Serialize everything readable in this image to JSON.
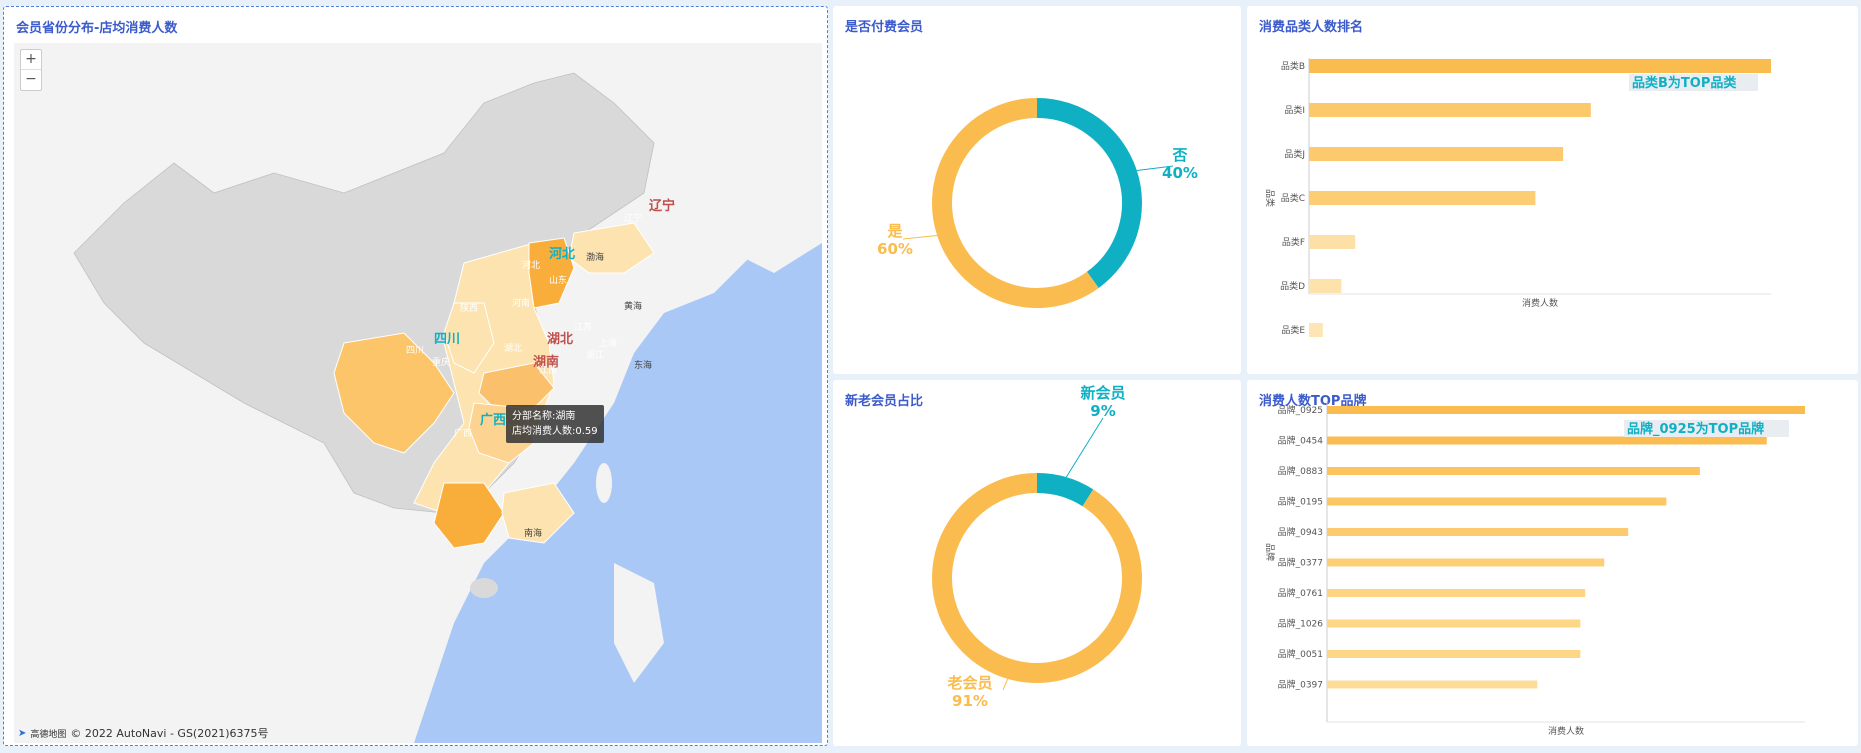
{
  "map_panel": {
    "title": "会员省份分布-店均消费人数",
    "zoom_in": "+",
    "zoom_out": "−",
    "credit": "高德地图",
    "copyright": "© 2022 AutoNavi - GS(2021)6375号",
    "tooltip_line1": "分部名称:湖南",
    "tooltip_line2": "店均消费人数:0.59",
    "sea_labels": [
      "渤海",
      "黄海",
      "东海",
      "南海"
    ],
    "region_labels": [
      "辽宁",
      "河北",
      "四川",
      "湖北",
      "湖南",
      "广西"
    ],
    "province_labels": [
      "辽宁",
      "河北",
      "山东",
      "陕西",
      "河南",
      "江苏",
      "四川",
      "重庆",
      "湖北",
      "上海",
      "浙江",
      "江西",
      "广西",
      "广东"
    ]
  },
  "pay_panel": {
    "title": "是否付费会员",
    "chart_data": {
      "type": "pie",
      "labels": [
        "否",
        "是"
      ],
      "values": [
        40,
        60
      ],
      "value_labels": [
        "40%",
        "60%"
      ],
      "colors": [
        "#0fb0c4",
        "#fbbc4f"
      ]
    }
  },
  "category_panel": {
    "title": "消费品类人数排名",
    "annotation": "品类B为TOP品类",
    "chart_data": {
      "type": "bar",
      "orientation": "horizontal",
      "categories": [
        "品类B",
        "品类I",
        "品类J",
        "品类C",
        "品类F",
        "品类D",
        "品类E"
      ],
      "values": [
        100,
        61,
        55,
        49,
        10,
        7,
        3
      ],
      "ylabel": "品类",
      "xlabel": "消费人数",
      "colors": [
        "#fbbc4f",
        "#fcc96a",
        "#fcca6c",
        "#fccd72",
        "#fde0a5",
        "#fde3ab",
        "#fde6b3"
      ]
    }
  },
  "new_panel": {
    "title": "新老会员占比",
    "chart_data": {
      "type": "pie",
      "labels": [
        "新会员",
        "老会员"
      ],
      "values": [
        9,
        91
      ],
      "value_labels": [
        "9%",
        "91%"
      ],
      "colors": [
        "#0fb0c4",
        "#fbbc4f"
      ]
    }
  },
  "brand_panel": {
    "title": "消费人数TOP品牌",
    "annotation": "品牌_0925为TOP品牌",
    "chart_data": {
      "type": "bar",
      "orientation": "horizontal",
      "categories": [
        "品牌_0925",
        "品牌_0454",
        "品牌_0883",
        "品牌_0195",
        "品牌_0943",
        "品牌_0377",
        "品牌_0761",
        "品牌_1026",
        "品牌_0051",
        "品牌_0397"
      ],
      "values": [
        100,
        92,
        78,
        71,
        63,
        58,
        54,
        53,
        53,
        44
      ],
      "ylabel": "品牌",
      "xlabel": "消费人数",
      "colors": [
        "#fbbc4f",
        "#fbbd52",
        "#fcc35e",
        "#fcc663",
        "#fccb6e",
        "#fccf77",
        "#fdd482",
        "#fdd686",
        "#fdd686",
        "#fddc98"
      ]
    }
  }
}
